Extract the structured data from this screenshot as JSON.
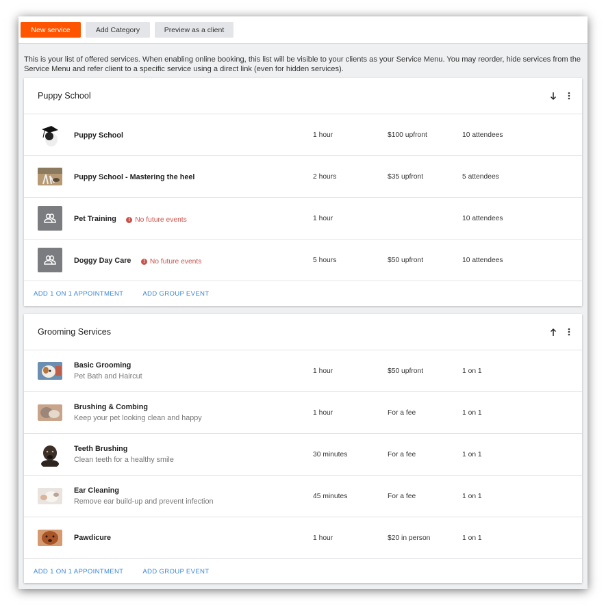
{
  "toolbar": {
    "new_service": "New service",
    "add_category": "Add Category",
    "preview": "Preview as a client"
  },
  "intro_text": "This is your list of offered services. When enabling online booking, this list will be visible to your clients as your Service Menu. You may reorder, hide services from the Service Menu and refer client to a specific service using a direct link (even for hidden services).",
  "categories": [
    {
      "title": "Puppy School",
      "sort_icon": "arrow-down-icon",
      "services": [
        {
          "name": "Puppy School",
          "desc": "",
          "warning": "",
          "duration": "1 hour",
          "price": "$100 upfront",
          "capacity": "10 attendees",
          "thumb": "photo"
        },
        {
          "name": "Puppy School - Mastering the heel",
          "desc": "",
          "warning": "",
          "duration": "2 hours",
          "price": "$35 upfront",
          "capacity": "5 attendees",
          "thumb": "photo"
        },
        {
          "name": "Pet Training",
          "desc": "",
          "warning": "No future events",
          "duration": "1 hour",
          "price": "",
          "capacity": "10 attendees",
          "thumb": "group-icon"
        },
        {
          "name": "Doggy Day Care",
          "desc": "",
          "warning": "No future events",
          "duration": "5 hours",
          "price": "$50 upfront",
          "capacity": "10 attendees",
          "thumb": "group-icon"
        }
      ],
      "links": {
        "one_on_one": "ADD 1 ON 1 APPOINTMENT",
        "group": "ADD GROUP EVENT"
      }
    },
    {
      "title": "Grooming Services",
      "sort_icon": "arrow-up-icon",
      "services": [
        {
          "name": "Basic Grooming",
          "desc": "Pet Bath and Haircut",
          "warning": "",
          "duration": "1 hour",
          "price": "$50 upfront",
          "capacity": "1 on 1",
          "thumb": "photo"
        },
        {
          "name": "Brushing & Combing",
          "desc": "Keep your pet looking clean and happy",
          "warning": "",
          "duration": "1 hour",
          "price": "For a fee",
          "capacity": "1 on 1",
          "thumb": "photo"
        },
        {
          "name": "Teeth Brushing",
          "desc": "Clean teeth for a healthy smile",
          "warning": "",
          "duration": "30 minutes",
          "price": "For a fee",
          "capacity": "1 on 1",
          "thumb": "photo"
        },
        {
          "name": "Ear Cleaning",
          "desc": "Remove ear build-up and prevent infection",
          "warning": "",
          "duration": "45 minutes",
          "price": "For a fee",
          "capacity": "1 on 1",
          "thumb": "photo"
        },
        {
          "name": "Pawdicure",
          "desc": "",
          "warning": "",
          "duration": "1 hour",
          "price": "$20 in person",
          "capacity": "1 on 1",
          "thumb": "photo"
        }
      ],
      "links": {
        "one_on_one": "ADD 1 ON 1 APPOINTMENT",
        "group": "ADD GROUP EVENT"
      }
    }
  ],
  "colors": {
    "primary": "#ff5500",
    "link": "#3b86d8",
    "warning": "#c9514a"
  }
}
